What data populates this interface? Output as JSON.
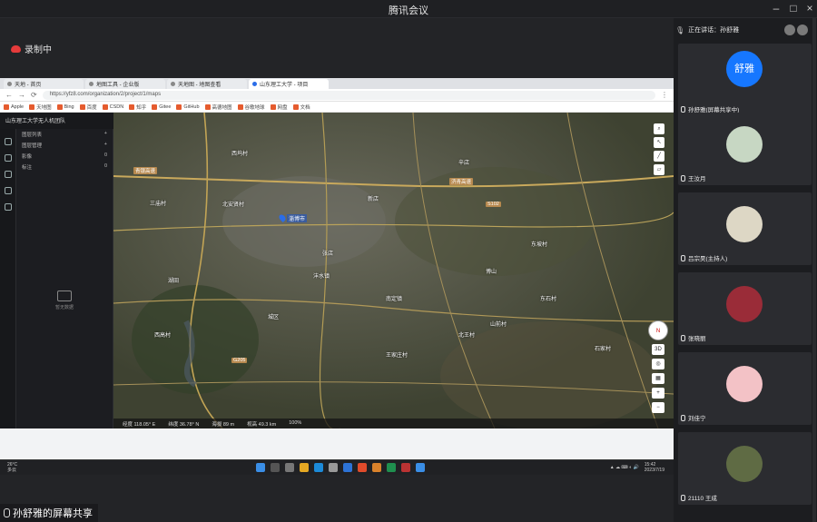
{
  "window": {
    "title": "腾讯会议"
  },
  "share_top": {
    "badge": "录制中"
  },
  "browser": {
    "tabs": [
      "天地 - 首页",
      "地图工具 - 企业版",
      "天地图 - 地图查看",
      "山东理工大学 - 项目"
    ],
    "url": "https://yfz8.com/organization/2/project/1/maps",
    "bookmarks": [
      "Apple",
      "天地图",
      "Bing",
      "百度",
      "CSDN",
      "知乎",
      "Gitee",
      "GitHub",
      "高德地图",
      "谷歌地球",
      "网盘",
      "文档"
    ]
  },
  "app": {
    "header": "山东理工大学无人机团队",
    "panel_title": "图层列表",
    "rows": [
      [
        "图层管理",
        "+"
      ],
      [
        "影像",
        "0"
      ],
      [
        "标注",
        "0"
      ]
    ],
    "empty_text": "暂无数据",
    "pin_label": "淄博市",
    "status": [
      "经度 118.05° E",
      "纬度 36.78° N",
      "海拔 89 m",
      "视高 49.3 km",
      "100%"
    ]
  },
  "map_labels": [
    {
      "text": "西坞村"
    },
    {
      "text": "北安贤村"
    },
    {
      "text": "三庙村"
    },
    {
      "text": "张店"
    },
    {
      "text": "新店"
    },
    {
      "text": "博山"
    },
    {
      "text": "湖田"
    },
    {
      "text": "沣水镇"
    },
    {
      "text": "南定镇"
    },
    {
      "text": "东坡村"
    },
    {
      "text": "城区"
    },
    {
      "text": "辛店"
    },
    {
      "text": "王家庄村"
    },
    {
      "text": "西高村"
    },
    {
      "text": "北王村"
    },
    {
      "text": "东石村"
    },
    {
      "text": "山前村"
    },
    {
      "text": "石家村"
    }
  ],
  "road_labels": [
    "青银高速",
    "济青高速",
    "G205",
    "S102"
  ],
  "taskbar": {
    "weather": "26°C\n多云",
    "time": "15:42\n2023/7/19"
  },
  "share_bottom": {
    "label": "孙舒雅的屏幕共享"
  },
  "participants": {
    "speaker": "正在讲话：孙舒雅",
    "tiles": [
      {
        "name": "孙舒雅(屏幕共享中)",
        "avatar_text": "舒雅",
        "color": "#1677ff"
      },
      {
        "name": "王汝月",
        "avatar_text": "",
        "color": "#c7d7c3"
      },
      {
        "name": "吕宗昊(主持人)",
        "avatar_text": "",
        "color": "#ddd7c5"
      },
      {
        "name": "张晓丽",
        "avatar_text": "",
        "color": "#9a2c38"
      },
      {
        "name": "刘佳宁",
        "avatar_text": "",
        "color": "#f3c2c6"
      },
      {
        "name": "21110 王成",
        "avatar_text": "",
        "color": "#5f6b44"
      }
    ]
  }
}
